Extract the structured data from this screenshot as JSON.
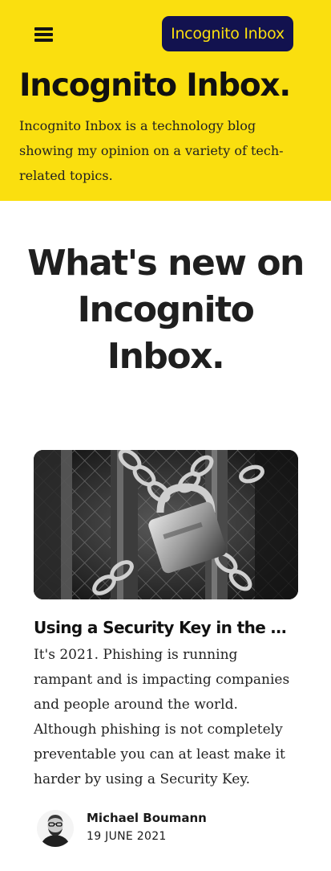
{
  "header": {
    "menu_icon": "hamburger-menu-icon",
    "brand_button_label": "Incognito Inbox",
    "site_title": "Incognito Inbox.",
    "site_description": "Incognito Inbox is a technology blog showing my opinion on a variety of tech-related topics."
  },
  "main": {
    "section_heading": "What's new on Incognito Inbox.",
    "posts": [
      {
        "title": "Using a Security Key in the world of phishing",
        "excerpt": "It's 2021. Phishing is running rampant and is impacting companies and people around the world. Although phishing is not completely preventable you can at least make it harder by using a Security Key.",
        "author": "Michael Boumann",
        "date": "19 JUNE 2021"
      }
    ]
  },
  "colors": {
    "hero_background": "#fadf0f",
    "brand_button_background": "#12124f",
    "brand_button_text": "#fadf0f",
    "text": "#1c1c1c"
  }
}
